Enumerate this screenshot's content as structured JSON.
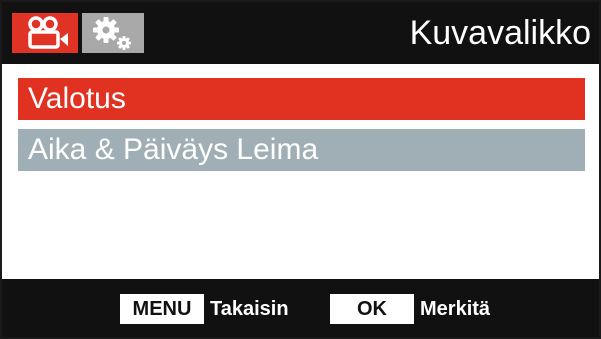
{
  "header": {
    "title": "Kuvavalikko",
    "tabs": [
      {
        "icon": "video-camera-icon",
        "active": true
      },
      {
        "icon": "settings-gears-icon",
        "active": false
      }
    ]
  },
  "menu": {
    "items": [
      {
        "label": "Valotus",
        "selected": true
      },
      {
        "label": "Aika & Päiväys Leima",
        "selected": false
      }
    ]
  },
  "footer": {
    "menu_key": "MENU",
    "menu_action": "Takaisin",
    "ok_key": "OK",
    "ok_action": "Merkitä"
  },
  "colors": {
    "accent": "#e03121",
    "inactive_item": "#a0aeb5",
    "bar": "#111111",
    "inactive_tab": "#a8a8a8"
  }
}
